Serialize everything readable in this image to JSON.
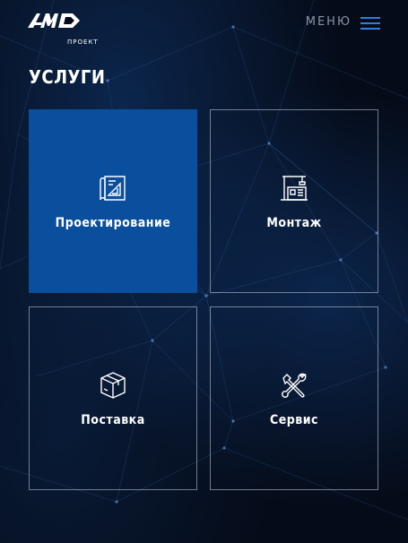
{
  "header": {
    "logo_text": "AMD",
    "logo_subtitle": "ПРОЕКТ",
    "menu_label": "МЕНЮ"
  },
  "page": {
    "title": "УСЛУГИ"
  },
  "services": [
    {
      "label": "Проектирование",
      "icon": "design-drawing-icon",
      "active": true
    },
    {
      "label": "Монтаж",
      "icon": "installation-crane-icon",
      "active": false
    },
    {
      "label": "Поставка",
      "icon": "box-icon",
      "active": false
    },
    {
      "label": "Сервис",
      "icon": "wrench-screwdriver-icon",
      "active": false
    }
  ],
  "colors": {
    "background": "#050b18",
    "accent": "#2d7fe0",
    "active_tile": "#0a4e9e",
    "tile_border": "#c8d2e1",
    "menu_label": "#8a93a6"
  }
}
